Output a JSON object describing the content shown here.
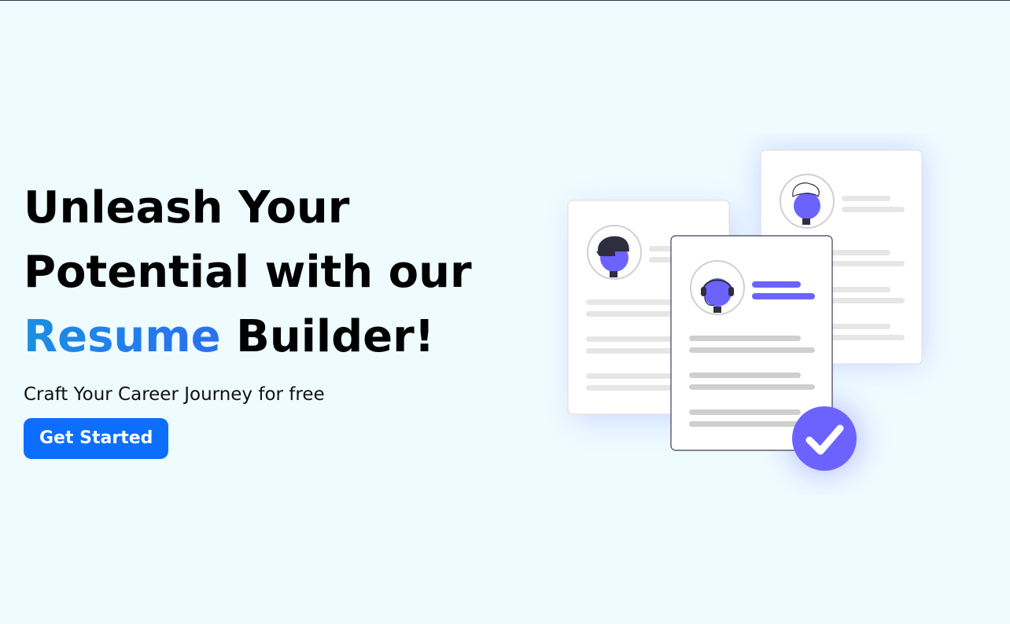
{
  "hero": {
    "headline_line1": "Unleash Your",
    "headline_line2": "Potential with our",
    "headline_accent": "Resume",
    "headline_end": " Builder!",
    "subtitle": "Craft Your Career Journey for free",
    "cta_label": "Get Started"
  },
  "colors": {
    "background": "#eefbff",
    "cta": "#0d6efd",
    "accent_start": "#1a8fe3",
    "accent_end": "#2a6ff0",
    "illustration_purple": "#6c63ff"
  },
  "illustration": {
    "icons": [
      "resume-card-icon",
      "avatar-icon",
      "checkmark-icon"
    ]
  }
}
